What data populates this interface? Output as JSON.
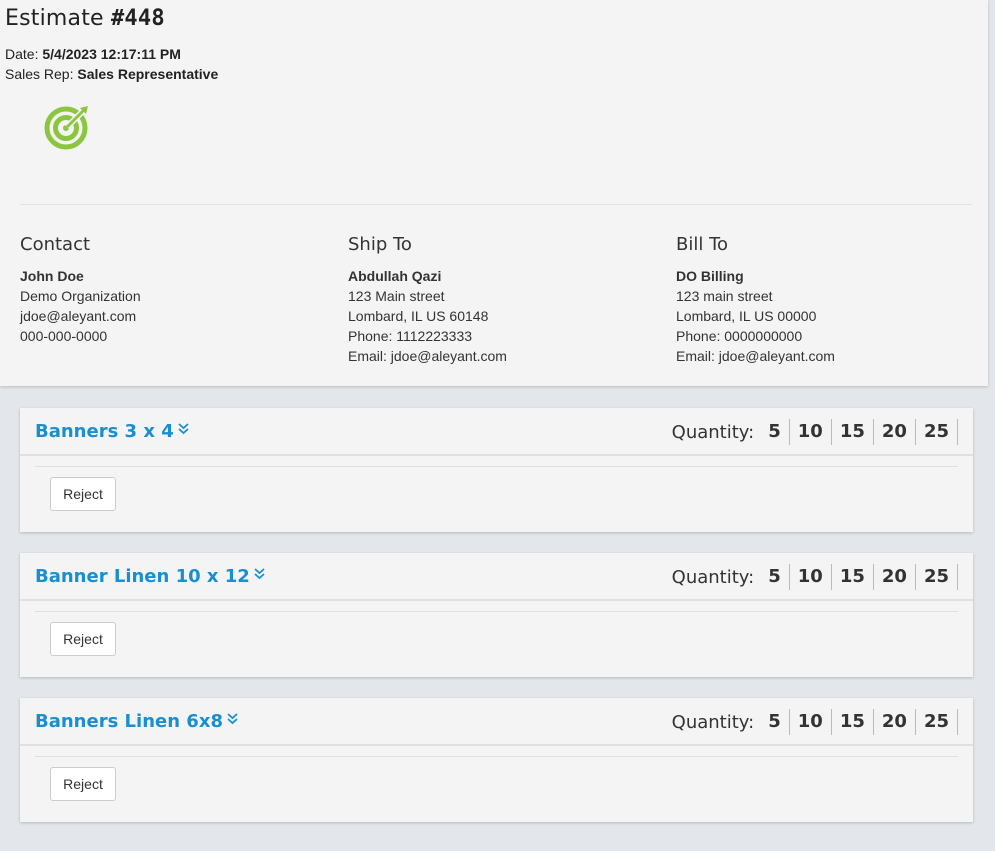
{
  "estimate": {
    "title_prefix": "Estimate",
    "number": "#448",
    "date_label": "Date:",
    "date_value": "5/4/2023 12:17:11 PM",
    "rep_label": "Sales Rep:",
    "rep_value": "Sales Representative"
  },
  "brand": {
    "logo_icon": "target-logo-icon",
    "accent": "#8cc63f"
  },
  "contact": {
    "heading": "Contact",
    "name": "John Doe",
    "organization": "Demo Organization",
    "email": "jdoe@aleyant.com",
    "phone": "000-000-0000"
  },
  "ship_to": {
    "heading": "Ship To",
    "name": "Abdullah Qazi",
    "street": "123 Main street",
    "city": "Lombard, IL US 60148",
    "phone": "Phone: 1112223333",
    "email": "Email: jdoe@aleyant.com"
  },
  "bill_to": {
    "heading": "Bill To",
    "name": "DO Billing",
    "street": "123 main street",
    "city": "Lombard, IL US 00000",
    "phone": "Phone: 0000000000",
    "email": "Email: jdoe@aleyant.com"
  },
  "items": [
    {
      "name": "Banners 3 x 4",
      "quantity_label": "Quantity:",
      "quantities": [
        "5",
        "10",
        "15",
        "20",
        "25"
      ],
      "reject_label": "Reject"
    },
    {
      "name": "Banner Linen 10 x 12",
      "quantity_label": "Quantity:",
      "quantities": [
        "5",
        "10",
        "15",
        "20",
        "25"
      ],
      "reject_label": "Reject"
    },
    {
      "name": "Banners Linen 6x8",
      "quantity_label": "Quantity:",
      "quantities": [
        "5",
        "10",
        "15",
        "20",
        "25"
      ],
      "reject_label": "Reject"
    }
  ],
  "colors": {
    "link": "#1a8fcf",
    "background": "#e3e6ea",
    "card": "#f4f4f4"
  }
}
